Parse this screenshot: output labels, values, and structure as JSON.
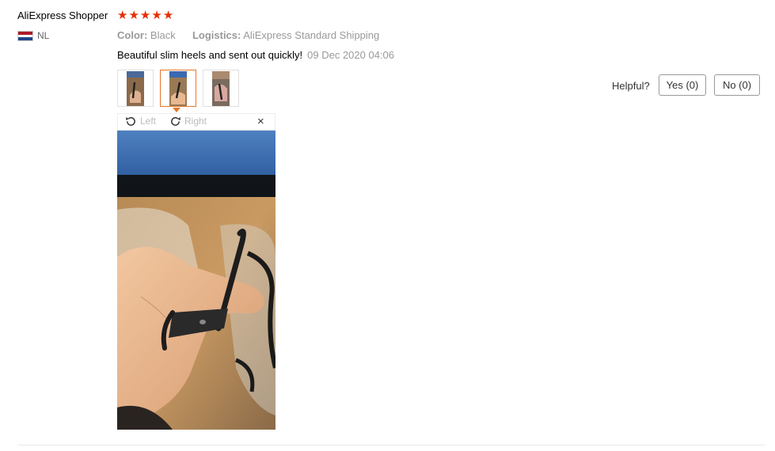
{
  "review": {
    "username": "AliExpress Shopper",
    "rating": 5,
    "country": "NL",
    "color_key": "Color:",
    "color_value": "Black",
    "logistics_key": "Logistics:",
    "logistics_value": "AliExpress Standard Shipping",
    "comment": "Beautiful slim heels and sent out quickly!",
    "date": "09 Dec 2020 04:06"
  },
  "helpful": {
    "label": "Helpful?",
    "yes_label": "Yes (0)",
    "no_label": "No (0)"
  },
  "viewer": {
    "rotate_left": "Left",
    "rotate_right": "Right",
    "close": "×",
    "active_thumb": 1
  },
  "colors": {
    "star": "#e62e04",
    "active_border": "#e4782b",
    "muted_text": "#999999"
  },
  "icons": {
    "star": "star-icon",
    "rotate_left": "rotate-left-icon",
    "rotate_right": "rotate-right-icon",
    "close": "close-icon",
    "flag": "netherlands-flag-icon"
  }
}
